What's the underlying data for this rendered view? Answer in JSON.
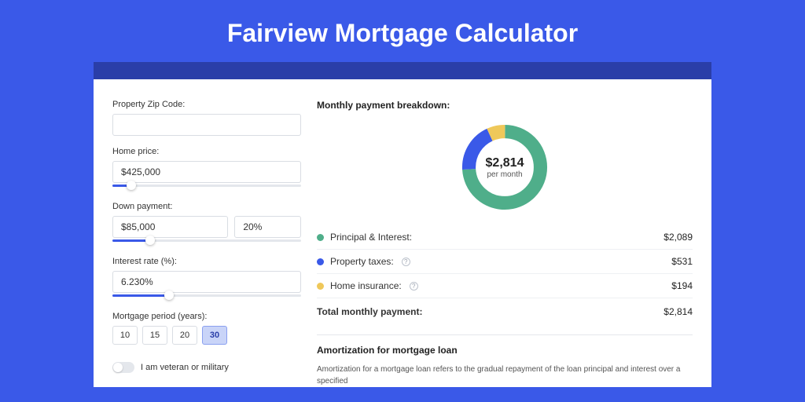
{
  "title": "Fairview Mortgage Calculator",
  "form": {
    "zip": {
      "label": "Property Zip Code:",
      "value": ""
    },
    "price": {
      "label": "Home price:",
      "value": "$425,000",
      "slider_pct": 10
    },
    "down": {
      "label": "Down payment:",
      "amount": "$85,000",
      "percent": "20%",
      "slider_pct": 20
    },
    "rate": {
      "label": "Interest rate (%):",
      "value": "6.230%",
      "slider_pct": 30
    },
    "period": {
      "label": "Mortgage period (years):",
      "options": [
        "10",
        "15",
        "20",
        "30"
      ],
      "selected": "30"
    },
    "veteran": {
      "label": "I am veteran or military",
      "on": false
    }
  },
  "breakdown": {
    "title": "Monthly payment breakdown:",
    "center_amount": "$2,814",
    "center_sub": "per month",
    "rows": [
      {
        "label": "Principal & Interest:",
        "value": "$2,089",
        "color": "g",
        "info": false
      },
      {
        "label": "Property taxes:",
        "value": "$531",
        "color": "b",
        "info": true
      },
      {
        "label": "Home insurance:",
        "value": "$194",
        "color": "y",
        "info": true
      }
    ],
    "total_label": "Total monthly payment:",
    "total_value": "$2,814"
  },
  "amort": {
    "title": "Amortization for mortgage loan",
    "text": "Amortization for a mortgage loan refers to the gradual repayment of the loan principal and interest over a specified"
  },
  "chart_data": {
    "type": "pie",
    "title": "Monthly payment breakdown",
    "series": [
      {
        "name": "Principal & Interest",
        "value": 2089,
        "color": "#4fae8a"
      },
      {
        "name": "Property taxes",
        "value": 531,
        "color": "#3a59e8"
      },
      {
        "name": "Home insurance",
        "value": 194,
        "color": "#efc85a"
      }
    ],
    "total": 2814
  },
  "colors": {
    "accent": "#3a59e8",
    "green": "#4fae8a",
    "yellow": "#efc85a"
  }
}
